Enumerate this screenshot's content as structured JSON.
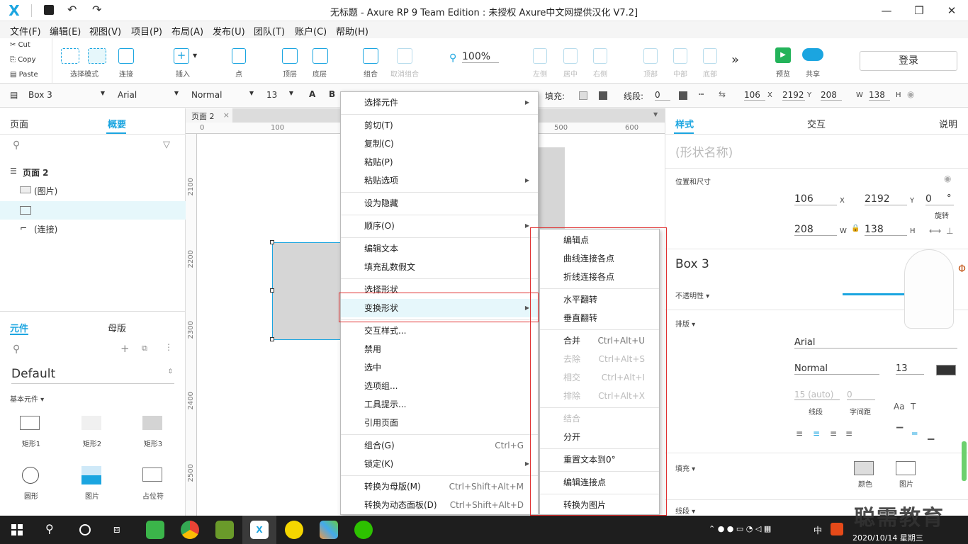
{
  "window": {
    "title": "无标题 - Axure RP 9 Team Edition : 未授权     Axure中文网提供汉化 V7.2]",
    "logo": "X",
    "minimize": "—",
    "maximize": "❐",
    "close": "✕"
  },
  "menus": [
    "文件(F)",
    "编辑(E)",
    "视图(V)",
    "项目(P)",
    "布局(A)",
    "发布(U)",
    "团队(T)",
    "账户(C)",
    "帮助(H)"
  ],
  "clipboard": {
    "cut": "Cut",
    "copy": "Copy",
    "paste": "Paste"
  },
  "toolbar": {
    "select_mode": "选择模式",
    "connect": "连接",
    "insert": "插入",
    "point": "点",
    "top_layer": "顶层",
    "bottom_layer": "底层",
    "group": "组合",
    "ungroup": "取消组合",
    "zoom": "100%",
    "align_left": "左侧",
    "align_center": "居中",
    "align_right": "右侧",
    "align_top": "顶部",
    "align_middle": "中部",
    "align_bottom": "底部",
    "more": "»",
    "preview": "预览",
    "share": "共享",
    "login": "登录"
  },
  "propbar": {
    "widget": "Box 3",
    "font": "Arial",
    "style": "Normal",
    "size": "13",
    "fill_label": "填充:",
    "line_label": "线段:",
    "line_value": "0",
    "x": "106",
    "x_label": "X",
    "y": "2192",
    "y_label": "Y",
    "w": "208",
    "w_label": "W",
    "h": "138",
    "h_label": "H"
  },
  "left": {
    "tab_pages": "页面",
    "tab_outline": "概要",
    "outline_root": "页面 2",
    "outline_items": [
      "(图片)",
      "",
      "(连接)"
    ],
    "lib_tab_widgets": "元件",
    "lib_tab_masters": "母版",
    "lib_name": "Default",
    "lib_category": "基本元件 ▾",
    "widgets": [
      "矩形1",
      "矩形2",
      "矩形3",
      "圆形",
      "图片",
      "占位符"
    ]
  },
  "canvas": {
    "page_tab": "页面 2",
    "ruler_top": [
      "0",
      "100",
      "500",
      "600"
    ],
    "ruler_left": [
      "2100",
      "2200",
      "2300",
      "2400",
      "2500"
    ]
  },
  "context_menu": [
    {
      "label": "选择元件",
      "arrow": true
    },
    {
      "sep": true
    },
    {
      "label": "剪切(T)"
    },
    {
      "label": "复制(C)"
    },
    {
      "label": "粘贴(P)"
    },
    {
      "label": "粘贴选项",
      "arrow": true
    },
    {
      "sep": true
    },
    {
      "label": "设为隐藏"
    },
    {
      "sep": true
    },
    {
      "label": "顺序(O)",
      "arrow": true
    },
    {
      "sep": true
    },
    {
      "label": "编辑文本"
    },
    {
      "label": "填充乱数假文"
    },
    {
      "sep": true
    },
    {
      "label": "选择形状"
    },
    {
      "label": "变换形状",
      "arrow": true,
      "hover": true
    },
    {
      "sep": true
    },
    {
      "label": "交互样式..."
    },
    {
      "label": "禁用"
    },
    {
      "label": "选中"
    },
    {
      "label": "选项组..."
    },
    {
      "label": "工具提示..."
    },
    {
      "label": "引用页面"
    },
    {
      "sep": true
    },
    {
      "label": "组合(G)",
      "shortcut": "Ctrl+G"
    },
    {
      "label": "锁定(K)",
      "arrow": true
    },
    {
      "sep": true
    },
    {
      "label": "转换为母版(M)",
      "shortcut": "Ctrl+Shift+Alt+M"
    },
    {
      "label": "转换为动态面板(D)",
      "shortcut": "Ctrl+Shift+Alt+D"
    }
  ],
  "submenu": [
    {
      "label": "编辑点"
    },
    {
      "label": "曲线连接各点"
    },
    {
      "label": "折线连接各点"
    },
    {
      "sep": true
    },
    {
      "label": "水平翻转"
    },
    {
      "label": "垂直翻转"
    },
    {
      "sep": true
    },
    {
      "label": "合并",
      "shortcut": "Ctrl+Alt+U"
    },
    {
      "label": "去除",
      "shortcut": "Ctrl+Alt+S",
      "disabled": true
    },
    {
      "label": "相交",
      "shortcut": "Ctrl+Alt+I",
      "disabled": true
    },
    {
      "label": "排除",
      "shortcut": "Ctrl+Alt+X",
      "disabled": true
    },
    {
      "sep": true
    },
    {
      "label": "结合",
      "disabled": true
    },
    {
      "label": "分开"
    },
    {
      "sep": true
    },
    {
      "label": "重置文本到0°"
    },
    {
      "sep": true
    },
    {
      "label": "编辑连接点"
    },
    {
      "sep": true
    },
    {
      "label": "转换为图片"
    }
  ],
  "right": {
    "tab_style": "样式",
    "tab_interact": "交互",
    "tab_notes": "说明",
    "shape_name_placeholder": "(形状名称)",
    "pos_size": "位置和尺寸",
    "x": "106",
    "x_label": "X",
    "y": "2192",
    "y_label": "Y",
    "rotation": "0",
    "rotation_unit": "°",
    "rotation_label": "旋转",
    "w": "208",
    "w_label": "W",
    "h": "138",
    "h_label": "H",
    "style_name": "Box 3",
    "opacity": "不透明性 ▾",
    "typography": "排版 ▾",
    "font": "Arial",
    "font_style": "Normal",
    "font_size": "13",
    "line_spacing": "15 (auto)",
    "char_spacing": "0",
    "line_spacing_label": "线段",
    "char_spacing_label": "字间距",
    "fill": "填充 ▾",
    "fill_color": "颜色",
    "fill_image": "图片",
    "border": "线段 ▾"
  },
  "taskbar": {
    "ime": "中",
    "date": "2020/10/14 星期三",
    "watermark": "聪需教育"
  },
  "colors": {
    "accent": "#1ba5e0",
    "highlight": "#e6f7fb",
    "red_box": "#e03030"
  }
}
